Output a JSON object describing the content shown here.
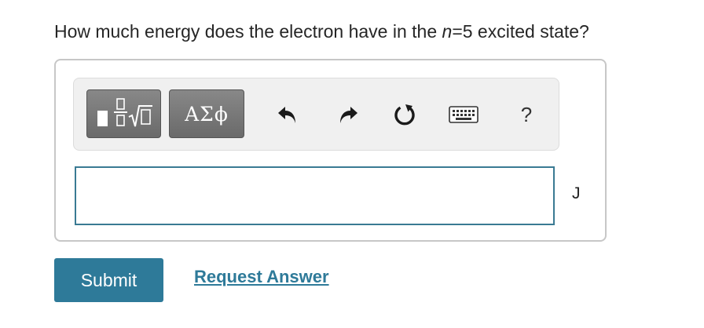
{
  "question": {
    "before": "How much energy does the electron have in the ",
    "variable": "n",
    "after": "=5 excited state?"
  },
  "toolbar": {
    "templates_icon": "fraction-sqrt-template-icon",
    "symbols_label": "ΑΣϕ",
    "undo_icon": "undo-arrow-icon",
    "redo_icon": "redo-arrow-icon",
    "reset_icon": "reset-circular-arrow-icon",
    "keyboard_icon": "keyboard-icon",
    "help_label": "?"
  },
  "answer": {
    "value": "",
    "unit": "J"
  },
  "actions": {
    "submit_label": "Submit",
    "request_label": "Request Answer"
  },
  "colors": {
    "accent": "#2e7a99",
    "input_border": "#3a7a93",
    "panel_border": "#c7c7c7",
    "toolbar_bg": "#f0f0f0",
    "button_gray": "#777777"
  }
}
